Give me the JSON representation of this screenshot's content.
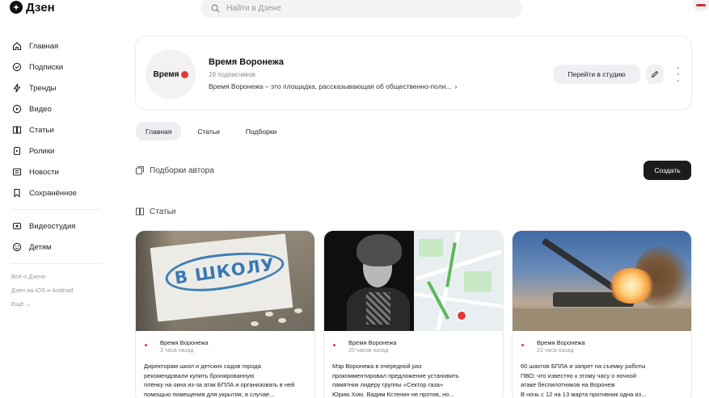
{
  "app": {
    "logo_text": "Дзен"
  },
  "search": {
    "placeholder": "Найти в Дзене"
  },
  "sidebar": {
    "items": [
      {
        "label": "Главная",
        "icon": "home-icon"
      },
      {
        "label": "Подписки",
        "icon": "subscriptions-icon"
      },
      {
        "label": "Тренды",
        "icon": "lightning-icon"
      },
      {
        "label": "Видео",
        "icon": "video-icon"
      },
      {
        "label": "Статьи",
        "icon": "articles-icon"
      },
      {
        "label": "Ролики",
        "icon": "shorts-icon"
      },
      {
        "label": "Новости",
        "icon": "news-icon"
      },
      {
        "label": "Сохранённое",
        "icon": "bookmark-icon"
      }
    ],
    "items2": [
      {
        "label": "Видеостудия",
        "icon": "studio-icon"
      },
      {
        "label": "Детям",
        "icon": "kids-icon"
      }
    ],
    "footer": {
      "about": "Всё о Дзене",
      "apps": "Дзен на iOS и Android",
      "more": "Ещё"
    }
  },
  "channel": {
    "name": "Время Воронежа",
    "subscribers": "19 подписчиков",
    "description": "Время Воронежа – это площадка, рассказывающая об общественно-поли...",
    "description_arrow": "›",
    "avatar_text": "Время",
    "studio_button": "Перейти в студию"
  },
  "tabs": [
    {
      "label": "Главная",
      "active": true
    },
    {
      "label": "Статьи",
      "active": false
    },
    {
      "label": "Подборки",
      "active": false
    }
  ],
  "sections": {
    "collections_title": "Подборки автора",
    "create_button": "Создать",
    "articles_title": "Статьи"
  },
  "articles": [
    {
      "author": "Время Воронежа",
      "time": "3 часа назад",
      "image_text": "В ШКОЛУ",
      "lines": [
        "Директорам школ и детских садов города",
        "рекомендовали купить бронированную",
        "плёнку на окна из-за атак БПЛА и организовать в ней",
        "помощью помещения для укрытия, в случае..."
      ]
    },
    {
      "author": "Время Воронежа",
      "time": "20 часов назад",
      "lines": [
        "Мэр Воронежа в очередной раз",
        "прокомментировал предложение установить",
        "памятник лидеру группы «Сектор газа»",
        "Юрию Хою. Вадим Кстенин не против, но..."
      ]
    },
    {
      "author": "Время Воронежа",
      "time": "22 часа назад",
      "lines": [
        "60 шахтов БПЛА и запрет на съемку работы",
        "ПВО: что известно к этому часу о ночной",
        "атаке беспилотников на Воронеж",
        "В ночь с 12 на 13 марта противник одна из..."
      ]
    }
  ],
  "colors": {
    "accent_red": "#e53935",
    "dark_button": "#1c1c1c",
    "chip_bg": "#eceef1"
  }
}
